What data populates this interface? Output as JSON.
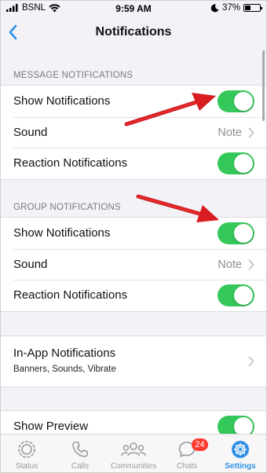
{
  "status_bar": {
    "carrier": "BSNL",
    "time": "9:59 AM",
    "battery_percent": "37%",
    "battery_level": 0.37
  },
  "nav": {
    "title": "Notifications",
    "back_icon": "chevron-left-icon"
  },
  "message_notifications": {
    "header": "MESSAGE NOTIFICATIONS",
    "show_notifications": {
      "label": "Show Notifications",
      "enabled": true
    },
    "sound": {
      "label": "Sound",
      "value": "Note"
    },
    "reaction_notifications": {
      "label": "Reaction Notifications",
      "enabled": true
    }
  },
  "group_notifications": {
    "header": "GROUP NOTIFICATIONS",
    "show_notifications": {
      "label": "Show Notifications",
      "enabled": true
    },
    "sound": {
      "label": "Sound",
      "value": "Note"
    },
    "reaction_notifications": {
      "label": "Reaction Notifications",
      "enabled": true
    }
  },
  "in_app": {
    "title": "In-App Notifications",
    "subtitle": "Banners, Sounds, Vibrate"
  },
  "show_preview": {
    "label": "Show Preview",
    "enabled": true
  },
  "tabs": [
    {
      "label": "Status",
      "icon": "status-icon",
      "active": false
    },
    {
      "label": "Calls",
      "icon": "phone-icon",
      "active": false
    },
    {
      "label": "Communities",
      "icon": "communities-icon",
      "active": false
    },
    {
      "label": "Chats",
      "icon": "chat-bubble-icon",
      "active": false,
      "badge": "24"
    },
    {
      "label": "Settings",
      "icon": "gear-icon",
      "active": true
    }
  ],
  "colors": {
    "toggle_on": "#34c759",
    "accent_blue": "#2f8fe6",
    "annotation_arrow": "#e0181e",
    "badge_red": "#ff3b30"
  }
}
